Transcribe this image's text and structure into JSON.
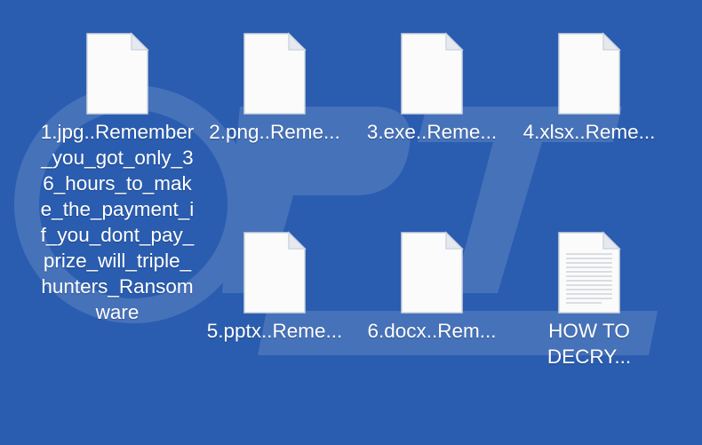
{
  "desktop": {
    "background_color": "#2a5db0",
    "files": [
      {
        "name": "1.jpg..Remember_you_got_only_36_hours_to_make_the_payment_if_you_dont_pay_prize_will_triple_hunters_Ransomware",
        "icon": "blank-file-icon"
      },
      {
        "name": "2.png..Reme...",
        "icon": "blank-file-icon"
      },
      {
        "name": "3.exe..Reme...",
        "icon": "blank-file-icon"
      },
      {
        "name": "4.xlsx..Reme...",
        "icon": "blank-file-icon"
      },
      {
        "name": "5.pptx..Reme...",
        "icon": "blank-file-icon"
      },
      {
        "name": "6.docx..Rem...",
        "icon": "blank-file-icon"
      },
      {
        "name": "HOW TO DECRY...",
        "icon": "text-file-icon"
      }
    ]
  }
}
